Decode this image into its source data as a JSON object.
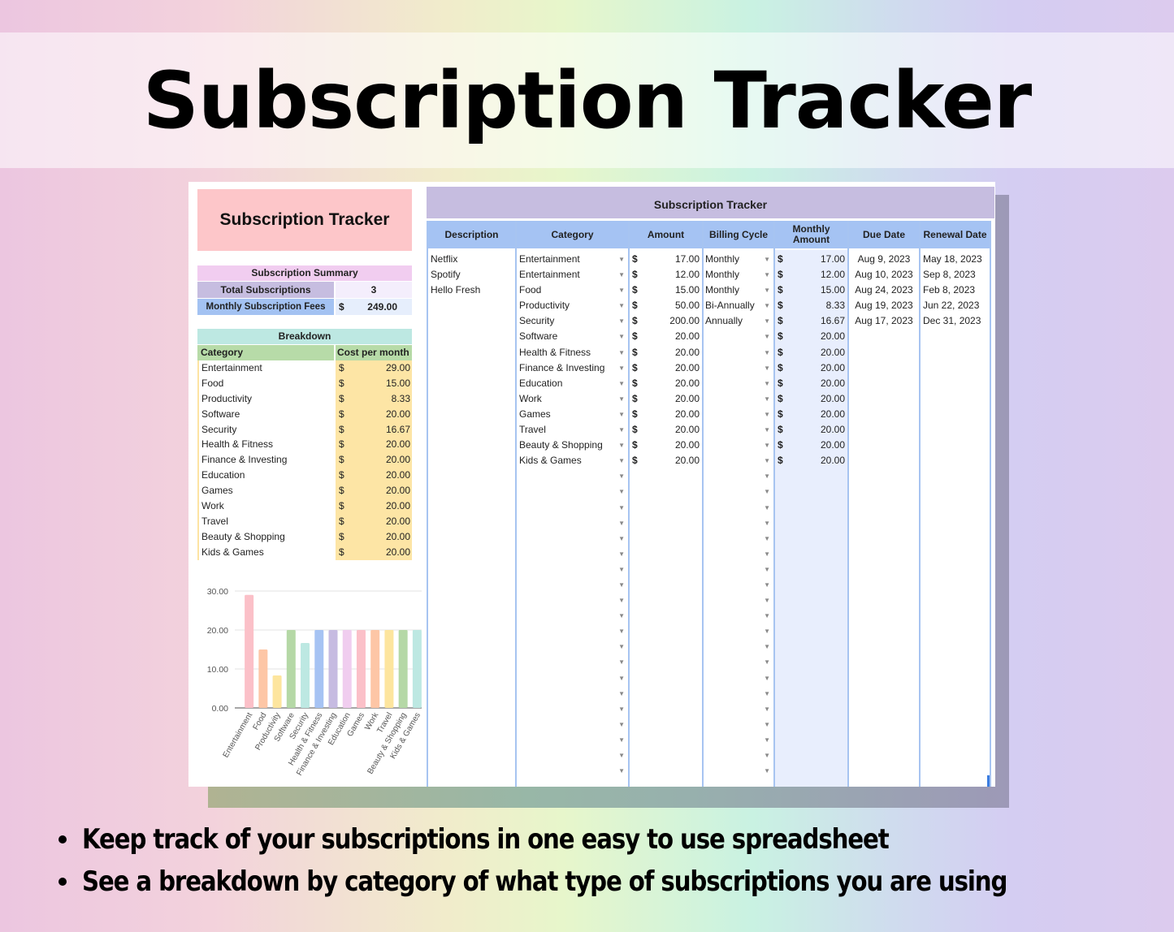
{
  "banner": {
    "title": "Subscription Tracker"
  },
  "left_panel": {
    "title": "Subscription Tracker",
    "summary": {
      "heading": "Subscription Summary",
      "total_label": "Total Subscriptions",
      "total_value": "3",
      "fees_label": "Monthly Subscription Fees",
      "fees_currency": "$",
      "fees_value": "249.00"
    },
    "breakdown": {
      "heading": "Breakdown",
      "col_category": "Category",
      "col_cost": "Cost per month",
      "rows": [
        {
          "category": "Entertainment",
          "currency": "$",
          "cost": "29.00"
        },
        {
          "category": "Food",
          "currency": "$",
          "cost": "15.00"
        },
        {
          "category": "Productivity",
          "currency": "$",
          "cost": "8.33"
        },
        {
          "category": "Software",
          "currency": "$",
          "cost": "20.00"
        },
        {
          "category": "Security",
          "currency": "$",
          "cost": "16.67"
        },
        {
          "category": "Health & Fitness",
          "currency": "$",
          "cost": "20.00"
        },
        {
          "category": "Finance & Investing",
          "currency": "$",
          "cost": "20.00"
        },
        {
          "category": "Education",
          "currency": "$",
          "cost": "20.00"
        },
        {
          "category": "Games",
          "currency": "$",
          "cost": "20.00"
        },
        {
          "category": "Work",
          "currency": "$",
          "cost": "20.00"
        },
        {
          "category": "Travel",
          "currency": "$",
          "cost": "20.00"
        },
        {
          "category": "Beauty & Shopping",
          "currency": "$",
          "cost": "20.00"
        },
        {
          "category": "Kids & Games",
          "currency": "$",
          "cost": "20.00"
        }
      ]
    }
  },
  "chart_data": {
    "type": "bar",
    "title": "",
    "xlabel": "",
    "ylabel": "",
    "ylim": [
      0,
      30
    ],
    "yticks": [
      "0.00",
      "10.00",
      "20.00",
      "30.00"
    ],
    "grid": true,
    "categories": [
      "Entertainment",
      "Food",
      "Productivity",
      "Software",
      "Security",
      "Health & Fitness",
      "Finance & Investing",
      "Education",
      "Games",
      "Work",
      "Travel",
      "Beauty & Shopping",
      "Kids & Games"
    ],
    "values": [
      29.0,
      15.0,
      8.33,
      20.0,
      16.67,
      20.0,
      20.0,
      20.0,
      20.0,
      20.0,
      20.0,
      20.0,
      20.0
    ],
    "colors": [
      "#fbc0c8",
      "#fdc6a6",
      "#fde59e",
      "#b5d8a6",
      "#bde8e2",
      "#a6c3f3",
      "#c6bbe1",
      "#f0cdef",
      "#fbc0c8",
      "#fdc6a6",
      "#fde59e",
      "#b5d8a6",
      "#bde8e2"
    ]
  },
  "tracker": {
    "title": "Subscription Tracker",
    "columns": [
      "Description",
      "Category",
      "Amount",
      "Billing Cycle",
      "Monthly Amount",
      "Due Date",
      "Renewal Date"
    ],
    "descriptions": [
      "Netflix",
      "Spotify",
      "Hello Fresh"
    ],
    "categories": [
      "Entertainment",
      "Entertainment",
      "Food",
      "Productivity",
      "Security",
      "Software",
      "Health & Fitness",
      "Finance & Investing",
      "Education",
      "Work",
      "Games",
      "Travel",
      "Beauty & Shopping",
      "Kids & Games"
    ],
    "amounts": [
      "17.00",
      "12.00",
      "15.00",
      "50.00",
      "200.00",
      "20.00",
      "20.00",
      "20.00",
      "20.00",
      "20.00",
      "20.00",
      "20.00",
      "20.00",
      "20.00"
    ],
    "billing_cycles": [
      "Monthly",
      "Monthly",
      "Monthly",
      "Bi-Annually",
      "Annually"
    ],
    "monthly_amounts": [
      "17.00",
      "12.00",
      "15.00",
      "8.33",
      "16.67",
      "20.00",
      "20.00",
      "20.00",
      "20.00",
      "20.00",
      "20.00",
      "20.00",
      "20.00",
      "20.00"
    ],
    "due_dates": [
      "Aug 9, 2023",
      "Aug 10, 2023",
      "Aug 24, 2023",
      "Aug 19, 2023",
      "Aug 17, 2023"
    ],
    "renewal_dates": [
      "May 18, 2023",
      "Sep 8, 2023",
      "Feb 8, 2023",
      "Jun 22, 2023",
      "Dec 31, 2023"
    ],
    "currency": "$",
    "dropdown_icon": "triangle-down"
  },
  "bullets": [
    "Keep track of your subscriptions in one easy to use spreadsheet",
    "See a breakdown by category of what type of subscriptions you are using"
  ]
}
